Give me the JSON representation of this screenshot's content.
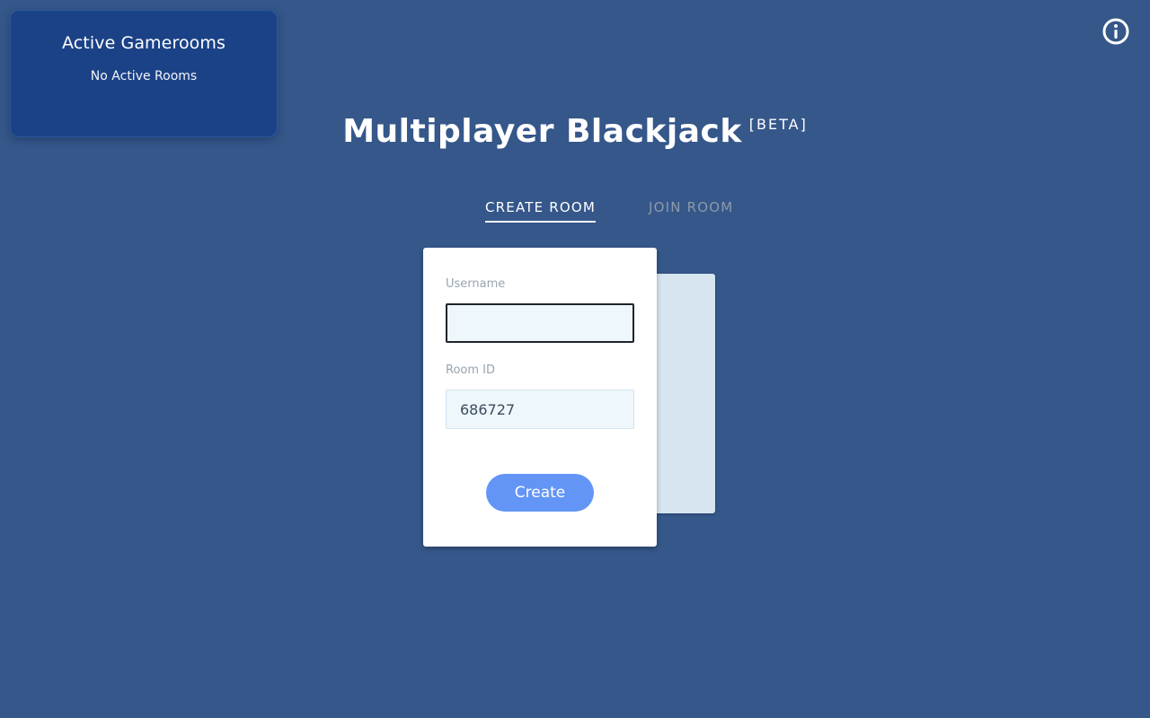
{
  "sidebar": {
    "title": "Active Gamerooms",
    "empty_text": "No Active Rooms"
  },
  "header": {
    "title": "Multiplayer Blackjack",
    "badge": "[BETA]",
    "info_icon": "info-circle-icon"
  },
  "tabs": [
    {
      "label": "CREATE ROOM",
      "active": true
    },
    {
      "label": "JOIN ROOM",
      "active": false
    }
  ],
  "form": {
    "username_label": "Username",
    "username_value": "",
    "room_id_label": "Room ID",
    "room_id_value": "686727",
    "submit_label": "Create"
  },
  "colors": {
    "background": "#35578a",
    "panel": "#1b4287",
    "button": "#6295f6",
    "input_bg": "#eef7fc"
  }
}
